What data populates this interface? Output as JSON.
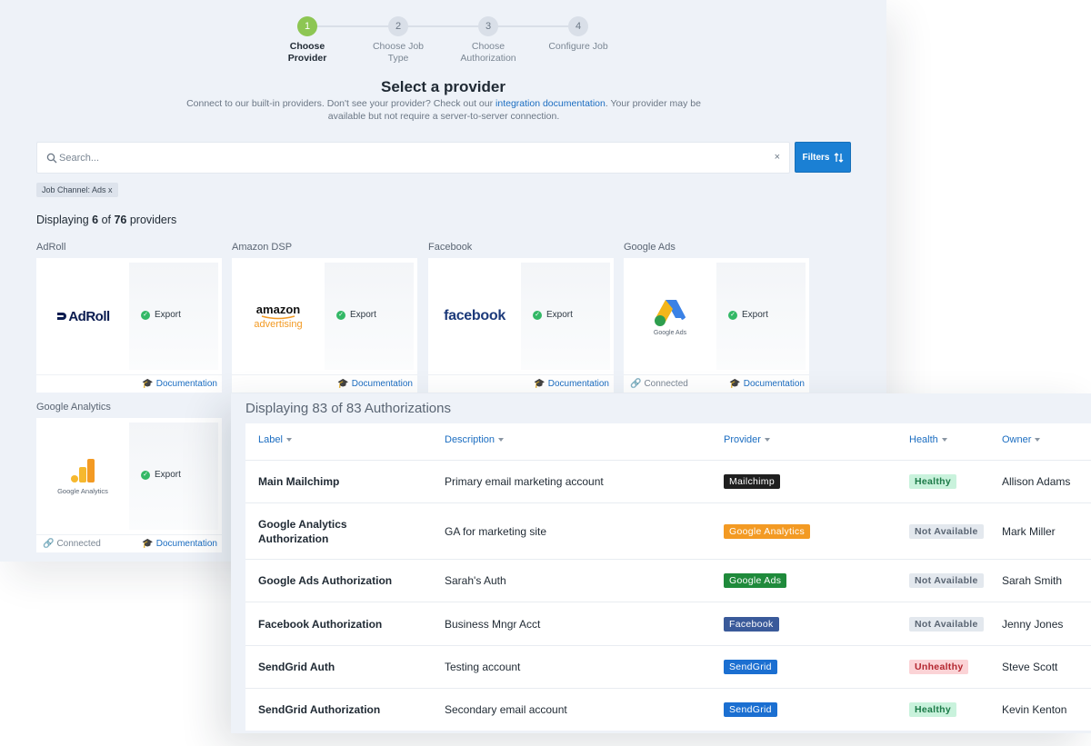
{
  "stepper": {
    "steps": [
      {
        "number": "1",
        "label_line1": "Choose",
        "label_line2": "Provider"
      },
      {
        "number": "2",
        "label_line1": "Choose Job",
        "label_line2": "Type"
      },
      {
        "number": "3",
        "label_line1": "Choose",
        "label_line2": "Authorization"
      },
      {
        "number": "4",
        "label_line1": "Configure Job",
        "label_line2": ""
      }
    ],
    "active_color": "#8dc653"
  },
  "header": {
    "title": "Select a provider",
    "subtitle_pre": "Connect to our built-in providers. Don't see your provider? Check out our ",
    "subtitle_link": "integration documentation",
    "subtitle_post": ". Your provider may be available but not require a server-to-server connection."
  },
  "search": {
    "placeholder": "Search...",
    "clear_icon": "close-icon",
    "filters_label": "Filters"
  },
  "filter_chip": "Job Channel: Ads x",
  "display": {
    "pre": "Displaying ",
    "shown": "6",
    "mid": " of ",
    "total": "76",
    "post": " providers"
  },
  "providers": [
    {
      "name": "AdRoll",
      "logo_text": "AdRoll",
      "action": "Export",
      "connected": "",
      "doc": "Documentation"
    },
    {
      "name": "Amazon DSP",
      "logo_text": "amazon",
      "logo_sub": "advertising",
      "action": "Export",
      "connected": "",
      "doc": "Documentation"
    },
    {
      "name": "Facebook",
      "logo_text": "facebook",
      "action": "Export",
      "connected": "",
      "doc": "Documentation"
    },
    {
      "name": "Google Ads",
      "logo_text": "Google Ads",
      "action": "Export",
      "connected": "Connected",
      "doc": "Documentation"
    },
    {
      "name": "Google Analytics",
      "logo_text": "Google Analytics",
      "action": "Export",
      "connected": "Connected",
      "doc": "Documentation"
    }
  ],
  "authorizations": {
    "title": "Displaying 83 of 83 Authorizations",
    "columns": [
      "Label",
      "Description",
      "Provider",
      "Health",
      "Owner"
    ],
    "rows": [
      {
        "label": "Main Mailchimp",
        "description": "Primary email marketing account",
        "provider": "Mailchimp",
        "provider_color": "#1f1f1f",
        "health": "Healthy",
        "health_bg": "#c9f2dc",
        "health_fg": "#1c7a48",
        "owner": "Allison Adams"
      },
      {
        "label": "Google Analytics Authorization",
        "description": "GA for marketing site",
        "provider": "Google Analytics",
        "provider_color": "#f39a23",
        "health": "Not Available",
        "health_bg": "#e3e8ee",
        "health_fg": "#5a6573",
        "owner": "Mark Miller"
      },
      {
        "label": "Google Ads Authorization",
        "description": "Sarah's Auth",
        "provider": "Google Ads",
        "provider_color": "#1f8a3b",
        "health": "Not Available",
        "health_bg": "#e3e8ee",
        "health_fg": "#5a6573",
        "owner": "Sarah Smith"
      },
      {
        "label": "Facebook Authorization",
        "description": "Business Mngr Acct",
        "provider": "Facebook",
        "provider_color": "#3a5a9a",
        "health": "Not Available",
        "health_bg": "#e3e8ee",
        "health_fg": "#5a6573",
        "owner": "Jenny Jones"
      },
      {
        "label": "SendGrid Auth",
        "description": "Testing account",
        "provider": "SendGrid",
        "provider_color": "#1b6fd1",
        "health": "Unhealthy",
        "health_bg": "#fbd3d6",
        "health_fg": "#b3262f",
        "owner": "Steve Scott"
      },
      {
        "label": "SendGrid Authorization",
        "description": "Secondary email account",
        "provider": "SendGrid",
        "provider_color": "#1b6fd1",
        "health": "Healthy",
        "health_bg": "#c9f2dc",
        "health_fg": "#1c7a48",
        "owner": "Kevin Kenton"
      }
    ]
  }
}
